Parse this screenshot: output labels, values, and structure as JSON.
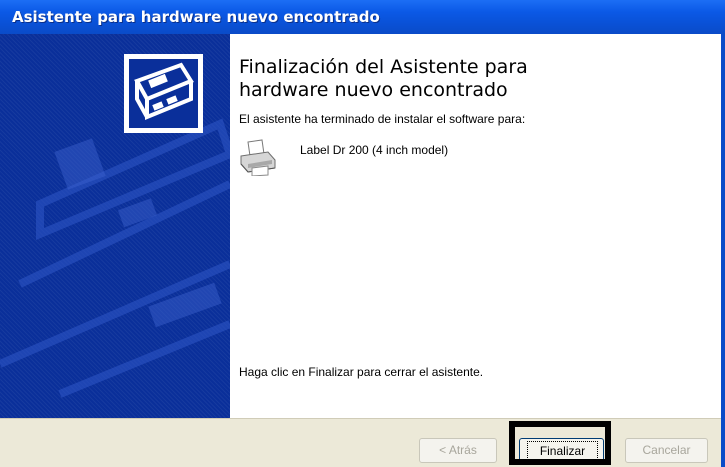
{
  "window": {
    "title": "Asistente para hardware nuevo encontrado"
  },
  "main": {
    "heading_line1": "Finalización del Asistente para",
    "heading_line2": "hardware nuevo encontrado",
    "subtext": "El asistente ha terminado de instalar el software para:",
    "device_name": "Label Dr 200 (4 inch model)",
    "finish_hint": "Haga clic en Finalizar para cerrar el asistente."
  },
  "buttons": {
    "back_label": "< Atrás",
    "finish_label": "Finalizar",
    "cancel_label": "Cancelar"
  },
  "icons": {
    "wizard": "hardware-card-icon",
    "device": "printer-icon"
  },
  "colors": {
    "title_bar": "#0a51d6",
    "side_panel": "#0a2f9a",
    "footer": "#ece9d8"
  }
}
